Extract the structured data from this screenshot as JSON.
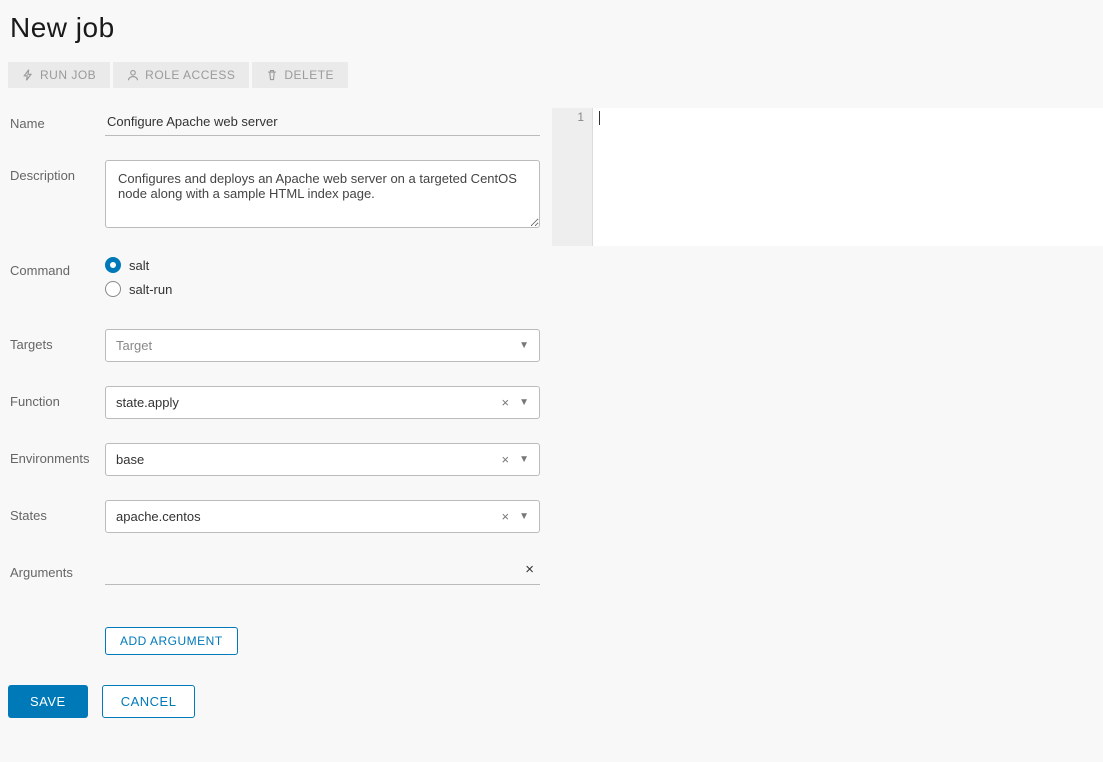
{
  "page": {
    "title": "New job"
  },
  "actions": {
    "run_job": "RUN JOB",
    "role_access": "ROLE ACCESS",
    "delete": "DELETE"
  },
  "form": {
    "name": {
      "label": "Name",
      "value": "Configure Apache web server"
    },
    "description": {
      "label": "Description",
      "value": "Configures and deploys an Apache web server on a targeted CentOS node along with a sample HTML index page."
    },
    "command": {
      "label": "Command",
      "options": [
        {
          "label": "salt",
          "checked": true
        },
        {
          "label": "salt-run",
          "checked": false
        }
      ]
    },
    "targets": {
      "label": "Targets",
      "placeholder": "Target",
      "value": ""
    },
    "function": {
      "label": "Function",
      "value": "state.apply"
    },
    "environments": {
      "label": "Environments",
      "value": "base"
    },
    "states": {
      "label": "States",
      "value": "apache.centos"
    },
    "arguments": {
      "label": "Arguments",
      "value": ""
    },
    "add_argument": "ADD ARGUMENT"
  },
  "editor": {
    "line_number": "1"
  },
  "footer": {
    "save": "SAVE",
    "cancel": "CANCEL"
  }
}
